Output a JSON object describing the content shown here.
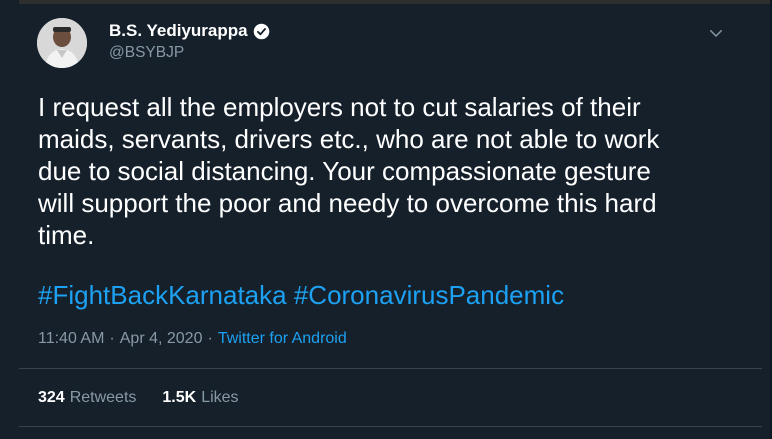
{
  "author": {
    "display_name": "B.S. Yediyurappa",
    "handle": "@BSYBJP",
    "verified_icon": "verified-badge-icon",
    "avatar_icon": "profile-photo"
  },
  "tweet": {
    "text": "I request all the employers not to cut salaries of their\nmaids, servants, drivers etc., who are not able to work\ndue to social distancing. Your compassionate gesture\nwill support the poor and needy to overcome this hard\ntime.",
    "hashtags": [
      "#FightBackKarnataka",
      "#CoronavirusPandemic"
    ]
  },
  "meta": {
    "time": "11:40 AM",
    "date": "Apr 4, 2020",
    "separator": "·",
    "source": "Twitter for Android"
  },
  "stats": {
    "retweets_count": "324",
    "retweets_label": "Retweets",
    "likes_count": "1.5K",
    "likes_label": "Likes"
  },
  "colors": {
    "background": "#15202b",
    "accent": "#1da1f2",
    "secondary_text": "#8899a6",
    "divider": "#38444d"
  }
}
